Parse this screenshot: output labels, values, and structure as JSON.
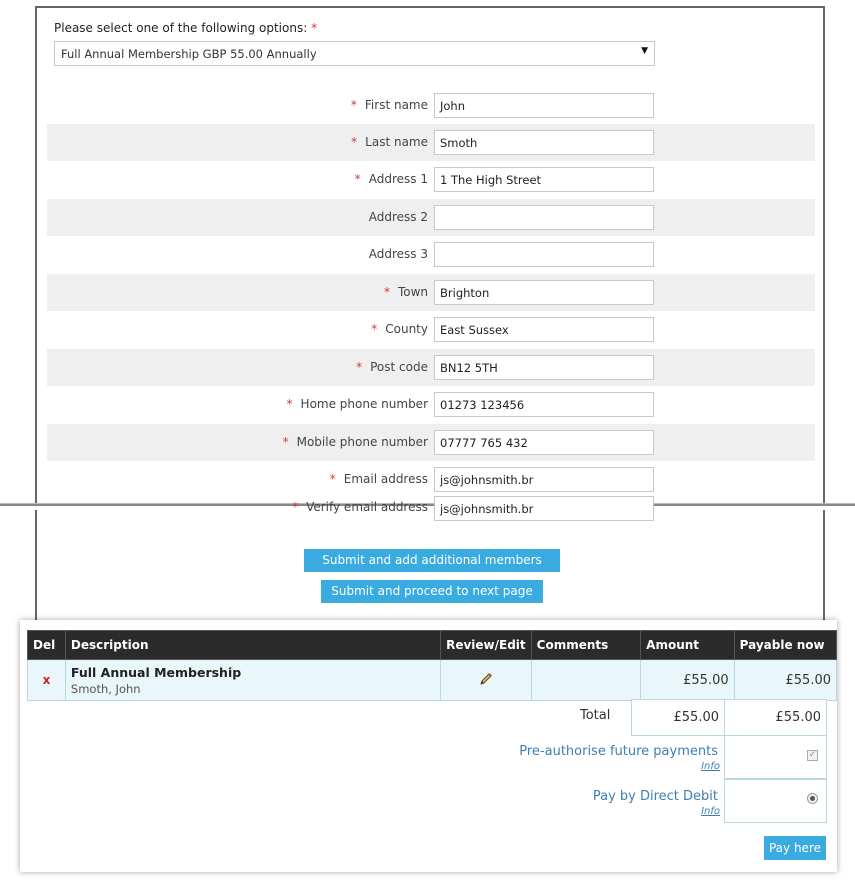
{
  "form": {
    "select_label": "Please select one of the following options:",
    "select_required": "*",
    "selected_option": "Full Annual Membership GBP 55.00 Annually",
    "fields": [
      {
        "label": "First name",
        "required": "*",
        "value": "John"
      },
      {
        "label": "Last name",
        "required": "*",
        "value": "Smoth"
      },
      {
        "label": "Address 1",
        "required": "*",
        "value": "1 The High Street"
      },
      {
        "label": "Address 2",
        "required": "",
        "value": ""
      },
      {
        "label": "Address 3",
        "required": "",
        "value": ""
      },
      {
        "label": "Town",
        "required": "*",
        "value": "Brighton"
      },
      {
        "label": "County",
        "required": "*",
        "value": "East Sussex"
      },
      {
        "label": "Post code",
        "required": "*",
        "value": "BN12 5TH"
      },
      {
        "label": "Home phone number",
        "required": "*",
        "value": "01273 123456"
      },
      {
        "label": "Mobile phone number",
        "required": "*",
        "value": "07777 765 432"
      },
      {
        "label": "Email address",
        "required": "*",
        "value": "js@johnsmith.br"
      },
      {
        "label": "Verify email address",
        "required": "*",
        "value": "js@johnsmith.br"
      }
    ],
    "submit_add_label": "Submit and add additional members",
    "submit_next_label": "Submit and proceed to next page"
  },
  "cart": {
    "headers": [
      "Del",
      "Description",
      "Review/Edit",
      "Comments",
      "Amount",
      "Payable now"
    ],
    "item": {
      "del": "x",
      "title": "Full Annual Membership",
      "subtitle": "Smoth, John",
      "edit_icon": "pencil-icon",
      "comments": "",
      "amount": "£55.00",
      "payable": "£55.00"
    },
    "total_label": "Total",
    "total_amount": "£55.00",
    "total_payable": "£55.00",
    "preauth_label": "Pre-authorise future payments",
    "direct_debit_label": "Pay by Direct Debit",
    "info_label": "Info",
    "pay_button": "Pay here"
  },
  "colors": {
    "accent": "#3aabe0",
    "required": "#d03a3a",
    "table_header": "#2b2b2b",
    "row_tint": "#e9f6fa",
    "link": "#3c7fb8"
  }
}
